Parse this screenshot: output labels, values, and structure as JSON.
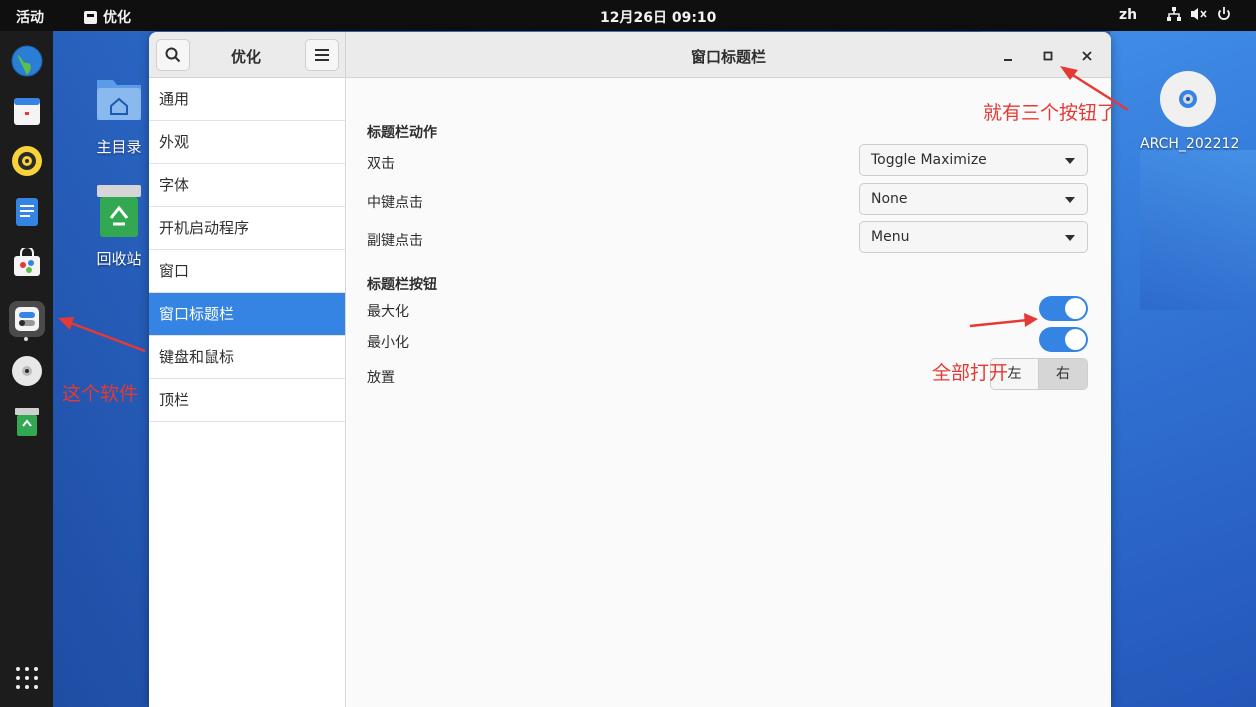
{
  "topbar": {
    "activities": "活动",
    "app_name": "优化",
    "clock": "12月26日 09:10",
    "lang": "zh"
  },
  "desktop": {
    "home_label": "主目录",
    "trash_label": "回收站",
    "disc_label": "ARCH_202212"
  },
  "window": {
    "sidebar_title": "优化",
    "title": "窗口标题栏",
    "sidebar_items": [
      "通用",
      "外观",
      "字体",
      "开机启动程序",
      "窗口",
      "窗口标题栏",
      "键盘和鼠标",
      "顶栏"
    ],
    "selected_index": 5
  },
  "content": {
    "actions_title": "标题栏动作",
    "double_click_label": "双击",
    "double_click_value": "Toggle Maximize",
    "middle_click_label": "中键点击",
    "middle_click_value": "None",
    "secondary_click_label": "副键点击",
    "secondary_click_value": "Menu",
    "buttons_title": "标题栏按钮",
    "maximize_label": "最大化",
    "maximize_on": true,
    "minimize_label": "最小化",
    "minimize_on": true,
    "placement_label": "放置",
    "placement_left": "左",
    "placement_right": "右",
    "placement_selected": "右"
  },
  "annotations": {
    "buttons_note": "就有三个按钮了",
    "toggle_note": "全部打开",
    "app_note": "这个软件"
  },
  "colors": {
    "accent": "#3584e4",
    "annotation": "#e53935",
    "topbar": "#0f0f0f"
  }
}
